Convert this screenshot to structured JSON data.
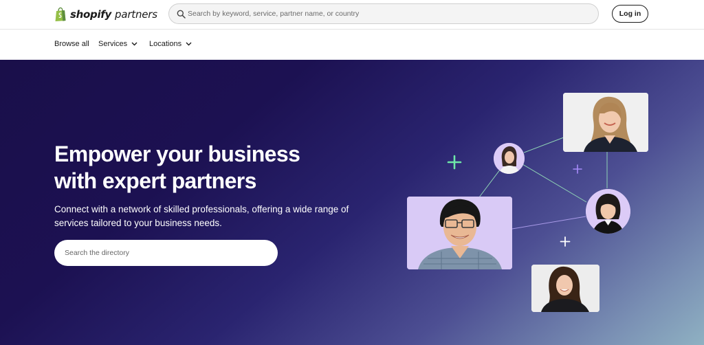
{
  "header": {
    "logo": {
      "brand": "shopify",
      "suffix": "partners",
      "icon": "shopify-bag-icon"
    },
    "search": {
      "placeholder": "Search by keyword, service, partner name, or country",
      "icon": "search-icon"
    },
    "login_label": "Log in"
  },
  "nav": {
    "items": [
      {
        "label": "Browse all"
      },
      {
        "label": "Services",
        "icon": "chevron-down-icon"
      },
      {
        "label": "Locations",
        "icon": "chevron-down-icon"
      }
    ]
  },
  "hero": {
    "title_line1": "Empower your business",
    "title_line2": "with expert partners",
    "subtitle": "Connect with a network of skilled professionals, offering a wide range of services tailored to your business needs.",
    "search_placeholder": "Search the directory"
  },
  "colors": {
    "brand_green": "#95bf47",
    "hero_dark": "#1a0f4a",
    "accent_plus_green": "#6ee7a8",
    "accent_plus_purple": "#a78bfa",
    "card_lavender": "#d7c8f5",
    "card_gray": "#ececec"
  }
}
